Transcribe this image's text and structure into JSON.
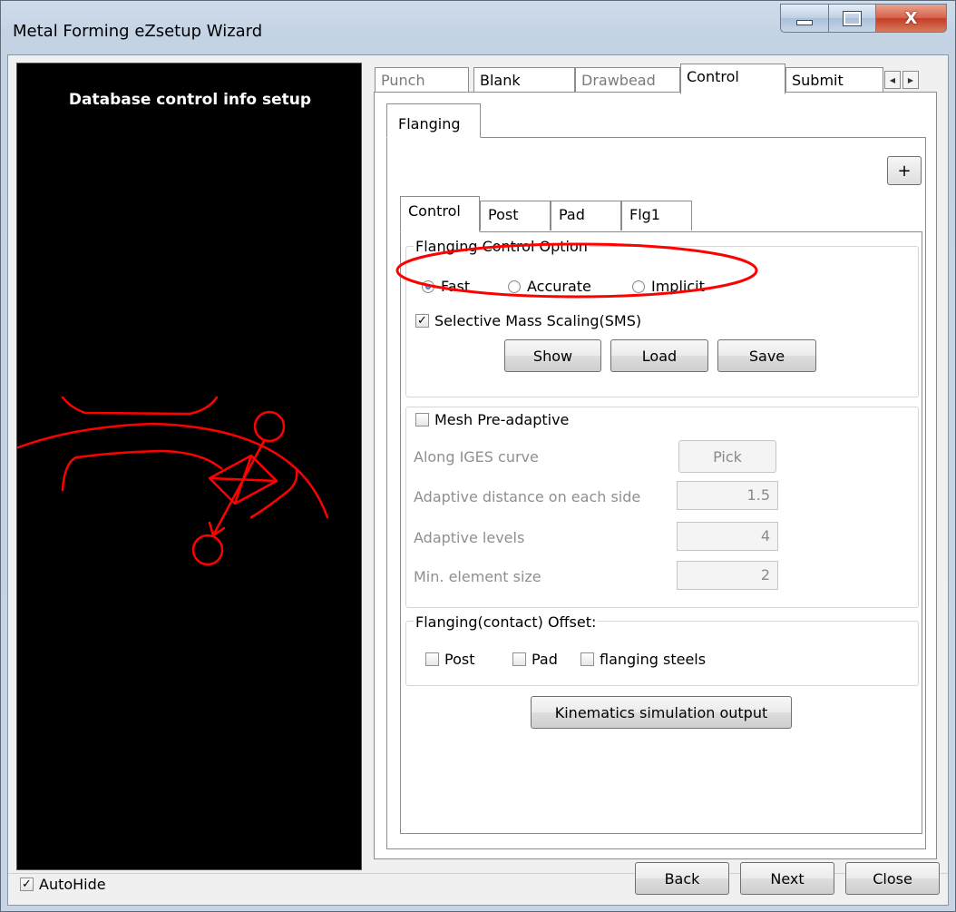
{
  "window": {
    "title": "Metal Forming eZsetup Wizard",
    "close_glyph": "X"
  },
  "left_panel": {
    "title": "Database control info setup",
    "sketch_color": "#ff0000"
  },
  "outer_tabs": [
    {
      "label": "Punch",
      "state": "disabled"
    },
    {
      "label": "Blank",
      "state": "normal"
    },
    {
      "label": "Drawbead",
      "state": "disabled"
    },
    {
      "label": "Control",
      "state": "active"
    },
    {
      "label": "Submit",
      "state": "normal"
    }
  ],
  "sub_tab": {
    "label": "Flanging"
  },
  "plus_button": {
    "label": "+"
  },
  "inner_tabs": [
    {
      "label": "Control",
      "state": "active"
    },
    {
      "label": "Post",
      "state": "normal"
    },
    {
      "label": "Pad",
      "state": "normal"
    },
    {
      "label": "Flg1",
      "state": "normal"
    }
  ],
  "control_option": {
    "title": "Flanging Control Option",
    "options": [
      {
        "label": "Fast",
        "selected": true
      },
      {
        "label": "Accurate",
        "selected": false
      },
      {
        "label": "Implicit",
        "selected": false
      }
    ],
    "sms_checkbox": {
      "label": "Selective Mass Scaling(SMS)",
      "checked": true
    },
    "buttons": {
      "show": "Show",
      "load": "Load",
      "save": "Save"
    },
    "highlight_color": "#ff0000"
  },
  "mesh": {
    "checkbox": {
      "label": "Mesh Pre-adaptive",
      "checked": false
    },
    "along_label": "Along IGES curve",
    "pick_label": "Pick",
    "rows": [
      {
        "label": "Adaptive distance on each side",
        "value": "1.5"
      },
      {
        "label": "Adaptive levels",
        "value": "4"
      },
      {
        "label": "Min. element size",
        "value": "2"
      }
    ]
  },
  "offset": {
    "title": "Flanging(contact) Offset:",
    "checks": [
      {
        "label": "Post",
        "checked": false
      },
      {
        "label": "Pad",
        "checked": false
      },
      {
        "label": "flanging steels",
        "checked": false
      }
    ]
  },
  "kinematics_button": {
    "label": "Kinematics simulation output"
  },
  "footer": {
    "autohide": {
      "label": "AutoHide",
      "checked": true
    },
    "back": "Back",
    "next": "Next",
    "close": "Close"
  }
}
